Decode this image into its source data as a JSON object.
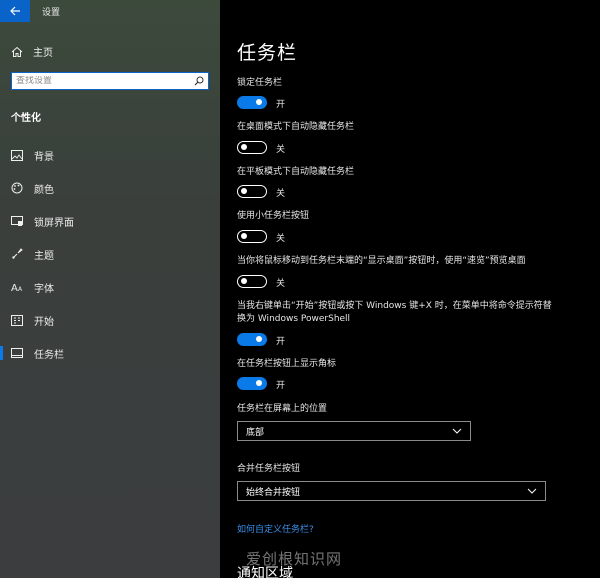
{
  "window": {
    "title": "设置"
  },
  "sidebar": {
    "home_label": "主页",
    "search_placeholder": "查找设置",
    "section_header": "个性化",
    "items": [
      {
        "label": "背景",
        "icon": "image-icon"
      },
      {
        "label": "颜色",
        "icon": "palette-icon"
      },
      {
        "label": "锁屏界面",
        "icon": "lock-screen-icon"
      },
      {
        "label": "主题",
        "icon": "theme-brush-icon"
      },
      {
        "label": "字体",
        "icon": "font-icon"
      },
      {
        "label": "开始",
        "icon": "start-menu-icon"
      },
      {
        "label": "任务栏",
        "icon": "taskbar-icon",
        "selected": true
      }
    ]
  },
  "main": {
    "title": "任务栏",
    "settings": [
      {
        "label": "锁定任务栏",
        "state": "开",
        "on": true
      },
      {
        "label": "在桌面模式下自动隐藏任务栏",
        "state": "关",
        "on": false
      },
      {
        "label": "在平板模式下自动隐藏任务栏",
        "state": "关",
        "on": false
      },
      {
        "label": "使用小任务栏按钮",
        "state": "关",
        "on": false
      },
      {
        "label": "当你将鼠标移动到任务栏末端的“显示桌面”按钮时，使用“速览”预览桌面",
        "state": "关",
        "on": false
      },
      {
        "label": "当我右键单击“开始”按钮或按下 Windows 键+X 时，在菜单中将命令提示符替换为 Windows PowerShell",
        "state": "开",
        "on": true
      },
      {
        "label": "在任务栏按钮上显示角标",
        "state": "开",
        "on": true
      }
    ],
    "position": {
      "label": "任务栏在屏幕上的位置",
      "value": "底部"
    },
    "combine": {
      "label": "合并任务栏按钮",
      "value": "始终合并按钮"
    },
    "help_link": "如何自定义任务栏?",
    "next_section": "通知区域"
  },
  "watermark": "爱创根知识网",
  "colors": {
    "accent": "#0a7ae8",
    "link": "#3a8ee8",
    "sidebar_bg": "#3b3f3d"
  }
}
